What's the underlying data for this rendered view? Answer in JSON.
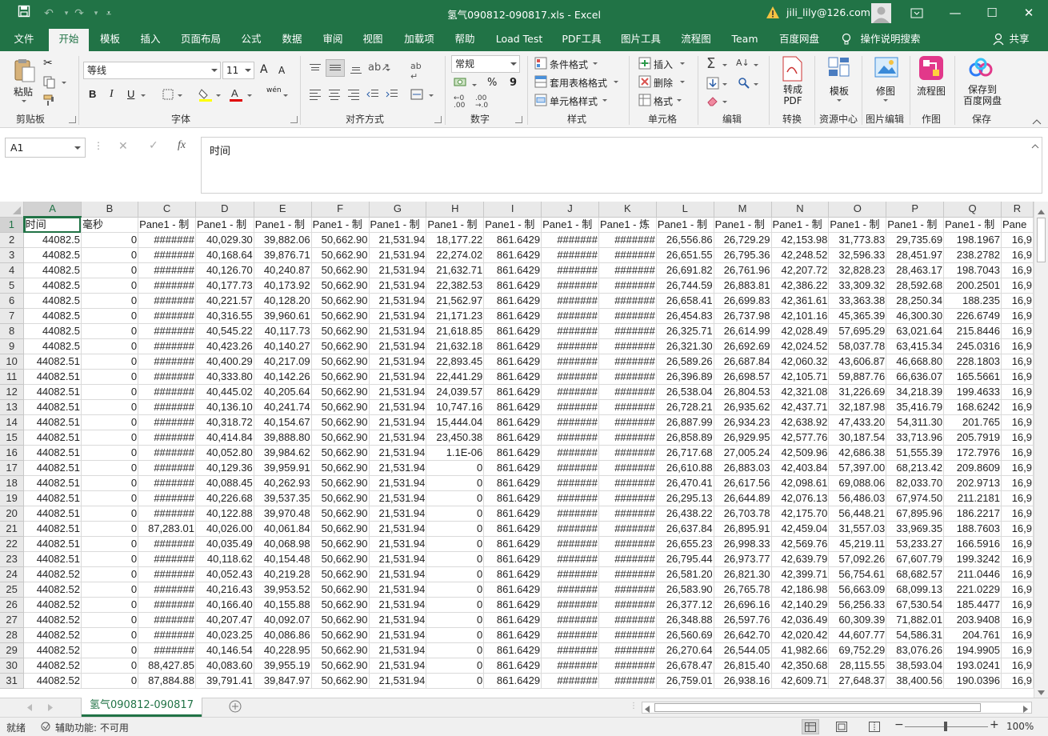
{
  "window": {
    "title": "氢气090812-090817.xls  -  Excel",
    "user": "jili_lily@126.com"
  },
  "tabs": [
    "文件",
    "开始",
    "模板",
    "插入",
    "页面布局",
    "公式",
    "数据",
    "审阅",
    "视图",
    "加载项",
    "帮助",
    "Load Test",
    "PDF工具",
    "图片工具",
    "流程图",
    "Team",
    "百度网盘",
    "操作说明搜索",
    "共享"
  ],
  "active_tab": "开始",
  "ribbon": {
    "clipboard": {
      "paste": "粘贴",
      "label": "剪贴板"
    },
    "font": {
      "name": "等线",
      "size": "11",
      "label": "字体",
      "bold": "B",
      "italic": "I",
      "underline": "U",
      "grow": "A",
      "shrink": "A",
      "phonetic": "wén"
    },
    "alignment": {
      "label": "对齐方式"
    },
    "number": {
      "format": "常规",
      "percent": "%",
      "comma": "9",
      "label": "数字"
    },
    "styles": {
      "conditional": "条件格式",
      "table": "套用表格格式",
      "cell": "单元格样式",
      "label": "样式"
    },
    "cells": {
      "insert": "插入",
      "delete": "删除",
      "format": "格式",
      "label": "单元格"
    },
    "editing": {
      "label": "编辑"
    },
    "convert": {
      "button": "转成\nPDF",
      "label": "转换"
    },
    "templates": {
      "button": "模板",
      "label": "资源中心"
    },
    "image_fix": {
      "button": "修图",
      "label": "图片编辑"
    },
    "flowchart": {
      "button": "流程图",
      "label": "作图"
    },
    "baidu": {
      "button": "保存到\n百度网盘",
      "label": "保存"
    }
  },
  "formula_bar": {
    "name_box": "A1",
    "fx": "fx",
    "content": "时间"
  },
  "columns": [
    "A",
    "B",
    "C",
    "D",
    "E",
    "F",
    "G",
    "H",
    "I",
    "J",
    "K",
    "L",
    "M",
    "N",
    "O",
    "P",
    "Q",
    "R"
  ],
  "header_row": [
    "时间",
    "毫秒",
    "Pane1 - 制",
    "Pane1 - 制",
    "Pane1 - 制",
    "Pane1 - 制",
    "Pane1 - 制",
    "Pane1 - 制",
    "Pane1 - 制",
    "Pane1 - 制",
    "Pane1 - 炼",
    "Pane1 - 制",
    "Pane1 - 制",
    "Pane1 - 制",
    "Pane1 - 制",
    "Pane1 - 制",
    "Pane1 - 制",
    "Pane"
  ],
  "rows": [
    [
      "2",
      "44082.5",
      "0",
      "#######",
      "40,029.30",
      "39,882.06",
      "50,662.90",
      "21,531.94",
      "18,177.22",
      "861.6429",
      "#######",
      "#######",
      "26,556.86",
      "26,729.29",
      "42,153.98",
      "31,773.83",
      "29,735.69",
      "198.1967",
      "16,9"
    ],
    [
      "3",
      "44082.5",
      "0",
      "#######",
      "40,168.64",
      "39,876.71",
      "50,662.90",
      "21,531.94",
      "22,274.02",
      "861.6429",
      "#######",
      "#######",
      "26,651.55",
      "26,795.36",
      "42,248.52",
      "32,596.33",
      "28,451.97",
      "238.2782",
      "16,9"
    ],
    [
      "4",
      "44082.5",
      "0",
      "#######",
      "40,126.70",
      "40,240.87",
      "50,662.90",
      "21,531.94",
      "21,632.71",
      "861.6429",
      "#######",
      "#######",
      "26,691.82",
      "26,761.96",
      "42,207.72",
      "32,828.23",
      "28,463.17",
      "198.7043",
      "16,9"
    ],
    [
      "5",
      "44082.5",
      "0",
      "#######",
      "40,177.73",
      "40,173.92",
      "50,662.90",
      "21,531.94",
      "22,382.53",
      "861.6429",
      "#######",
      "#######",
      "26,744.59",
      "26,883.81",
      "42,386.22",
      "33,309.32",
      "28,592.68",
      "200.2501",
      "16,9"
    ],
    [
      "6",
      "44082.5",
      "0",
      "#######",
      "40,221.57",
      "40,128.20",
      "50,662.90",
      "21,531.94",
      "21,562.97",
      "861.6429",
      "#######",
      "#######",
      "26,658.41",
      "26,699.83",
      "42,361.61",
      "33,363.38",
      "28,250.34",
      "188.235",
      "16,9"
    ],
    [
      "7",
      "44082.5",
      "0",
      "#######",
      "40,316.55",
      "39,960.61",
      "50,662.90",
      "21,531.94",
      "21,171.23",
      "861.6429",
      "#######",
      "#######",
      "26,454.83",
      "26,737.98",
      "42,101.16",
      "45,365.39",
      "46,300.30",
      "226.6749",
      "16,9"
    ],
    [
      "8",
      "44082.5",
      "0",
      "#######",
      "40,545.22",
      "40,117.73",
      "50,662.90",
      "21,531.94",
      "21,618.85",
      "861.6429",
      "#######",
      "#######",
      "26,325.71",
      "26,614.99",
      "42,028.49",
      "57,695.29",
      "63,021.64",
      "215.8446",
      "16,9"
    ],
    [
      "9",
      "44082.5",
      "0",
      "#######",
      "40,423.26",
      "40,140.27",
      "50,662.90",
      "21,531.94",
      "21,632.18",
      "861.6429",
      "#######",
      "#######",
      "26,321.30",
      "26,692.69",
      "42,024.52",
      "58,037.78",
      "63,415.34",
      "245.0316",
      "16,9"
    ],
    [
      "10",
      "44082.51",
      "0",
      "#######",
      "40,400.29",
      "40,217.09",
      "50,662.90",
      "21,531.94",
      "22,893.45",
      "861.6429",
      "#######",
      "#######",
      "26,589.26",
      "26,687.84",
      "42,060.32",
      "43,606.87",
      "46,668.80",
      "228.1803",
      "16,9"
    ],
    [
      "11",
      "44082.51",
      "0",
      "#######",
      "40,333.80",
      "40,142.26",
      "50,662.90",
      "21,531.94",
      "22,441.29",
      "861.6429",
      "#######",
      "#######",
      "26,396.89",
      "26,698.57",
      "42,105.71",
      "59,887.76",
      "66,636.07",
      "165.5661",
      "16,9"
    ],
    [
      "12",
      "44082.51",
      "0",
      "#######",
      "40,445.02",
      "40,205.64",
      "50,662.90",
      "21,531.94",
      "24,039.57",
      "861.6429",
      "#######",
      "#######",
      "26,538.04",
      "26,804.53",
      "42,321.08",
      "31,226.69",
      "34,218.39",
      "199.4633",
      "16,9"
    ],
    [
      "13",
      "44082.51",
      "0",
      "#######",
      "40,136.10",
      "40,241.74",
      "50,662.90",
      "21,531.94",
      "10,747.16",
      "861.6429",
      "#######",
      "#######",
      "26,728.21",
      "26,935.62",
      "42,437.71",
      "32,187.98",
      "35,416.79",
      "168.6242",
      "16,9"
    ],
    [
      "14",
      "44082.51",
      "0",
      "#######",
      "40,318.72",
      "40,154.67",
      "50,662.90",
      "21,531.94",
      "15,444.04",
      "861.6429",
      "#######",
      "#######",
      "26,887.99",
      "26,934.23",
      "42,638.92",
      "47,433.20",
      "54,311.30",
      "201.765",
      "16,9"
    ],
    [
      "15",
      "44082.51",
      "0",
      "#######",
      "40,414.84",
      "39,888.80",
      "50,662.90",
      "21,531.94",
      "23,450.38",
      "861.6429",
      "#######",
      "#######",
      "26,858.89",
      "26,929.95",
      "42,577.76",
      "30,187.54",
      "33,713.96",
      "205.7919",
      "16,9"
    ],
    [
      "16",
      "44082.51",
      "0",
      "#######",
      "40,052.80",
      "39,984.62",
      "50,662.90",
      "21,531.94",
      "1.1E-06",
      "861.6429",
      "#######",
      "#######",
      "26,717.68",
      "27,005.24",
      "42,509.96",
      "42,686.38",
      "51,555.39",
      "172.7976",
      "16,9"
    ],
    [
      "17",
      "44082.51",
      "0",
      "#######",
      "40,129.36",
      "39,959.91",
      "50,662.90",
      "21,531.94",
      "0",
      "861.6429",
      "#######",
      "#######",
      "26,610.88",
      "26,883.03",
      "42,403.84",
      "57,397.00",
      "68,213.42",
      "209.8609",
      "16,9"
    ],
    [
      "18",
      "44082.51",
      "0",
      "#######",
      "40,088.45",
      "40,262.93",
      "50,662.90",
      "21,531.94",
      "0",
      "861.6429",
      "#######",
      "#######",
      "26,470.41",
      "26,617.56",
      "42,098.61",
      "69,088.06",
      "82,033.70",
      "202.9713",
      "16,9"
    ],
    [
      "19",
      "44082.51",
      "0",
      "#######",
      "40,226.68",
      "39,537.35",
      "50,662.90",
      "21,531.94",
      "0",
      "861.6429",
      "#######",
      "#######",
      "26,295.13",
      "26,644.89",
      "42,076.13",
      "56,486.03",
      "67,974.50",
      "211.2181",
      "16,9"
    ],
    [
      "20",
      "44082.51",
      "0",
      "#######",
      "40,122.88",
      "39,970.48",
      "50,662.90",
      "21,531.94",
      "0",
      "861.6429",
      "#######",
      "#######",
      "26,438.22",
      "26,703.78",
      "42,175.70",
      "56,448.21",
      "67,895.96",
      "186.2217",
      "16,9"
    ],
    [
      "21",
      "44082.51",
      "0",
      "87,283.01",
      "40,026.00",
      "40,061.84",
      "50,662.90",
      "21,531.94",
      "0",
      "861.6429",
      "#######",
      "#######",
      "26,637.84",
      "26,895.91",
      "42,459.04",
      "31,557.03",
      "33,969.35",
      "188.7603",
      "16,9"
    ],
    [
      "22",
      "44082.51",
      "0",
      "#######",
      "40,035.49",
      "40,068.98",
      "50,662.90",
      "21,531.94",
      "0",
      "861.6429",
      "#######",
      "#######",
      "26,655.23",
      "26,998.33",
      "42,569.76",
      "45,219.11",
      "53,233.27",
      "166.5916",
      "16,9"
    ],
    [
      "23",
      "44082.51",
      "0",
      "#######",
      "40,118.62",
      "40,154.48",
      "50,662.90",
      "21,531.94",
      "0",
      "861.6429",
      "#######",
      "#######",
      "26,795.44",
      "26,973.77",
      "42,639.79",
      "57,092.26",
      "67,607.79",
      "199.3242",
      "16,9"
    ],
    [
      "24",
      "44082.52",
      "0",
      "#######",
      "40,052.43",
      "40,219.28",
      "50,662.90",
      "21,531.94",
      "0",
      "861.6429",
      "#######",
      "#######",
      "26,581.20",
      "26,821.30",
      "42,399.71",
      "56,754.61",
      "68,682.57",
      "211.0446",
      "16,9"
    ],
    [
      "25",
      "44082.52",
      "0",
      "#######",
      "40,216.43",
      "39,953.52",
      "50,662.90",
      "21,531.94",
      "0",
      "861.6429",
      "#######",
      "#######",
      "26,583.90",
      "26,765.78",
      "42,186.98",
      "56,663.09",
      "68,099.13",
      "221.0229",
      "16,9"
    ],
    [
      "26",
      "44082.52",
      "0",
      "#######",
      "40,166.40",
      "40,155.88",
      "50,662.90",
      "21,531.94",
      "0",
      "861.6429",
      "#######",
      "#######",
      "26,377.12",
      "26,696.16",
      "42,140.29",
      "56,256.33",
      "67,530.54",
      "185.4477",
      "16,9"
    ],
    [
      "27",
      "44082.52",
      "0",
      "#######",
      "40,207.47",
      "40,092.07",
      "50,662.90",
      "21,531.94",
      "0",
      "861.6429",
      "#######",
      "#######",
      "26,348.88",
      "26,597.76",
      "42,036.49",
      "60,309.39",
      "71,882.01",
      "203.9408",
      "16,9"
    ],
    [
      "28",
      "44082.52",
      "0",
      "#######",
      "40,023.25",
      "40,086.86",
      "50,662.90",
      "21,531.94",
      "0",
      "861.6429",
      "#######",
      "#######",
      "26,560.69",
      "26,642.70",
      "42,020.42",
      "44,607.77",
      "54,586.31",
      "204.761",
      "16,9"
    ],
    [
      "29",
      "44082.52",
      "0",
      "#######",
      "40,146.54",
      "40,228.95",
      "50,662.90",
      "21,531.94",
      "0",
      "861.6429",
      "#######",
      "#######",
      "26,270.64",
      "26,544.05",
      "41,982.66",
      "69,752.29",
      "83,076.26",
      "194.9905",
      "16,9"
    ],
    [
      "30",
      "44082.52",
      "0",
      "88,427.85",
      "40,083.60",
      "39,955.19",
      "50,662.90",
      "21,531.94",
      "0",
      "861.6429",
      "#######",
      "#######",
      "26,678.47",
      "26,815.40",
      "42,350.68",
      "28,115.55",
      "38,593.04",
      "193.0241",
      "16,9"
    ],
    [
      "31",
      "44082.52",
      "0",
      "87,884.88",
      "39,791.41",
      "39,847.97",
      "50,662.90",
      "21,531.94",
      "0",
      "861.6429",
      "#######",
      "#######",
      "26,759.01",
      "26,938.16",
      "42,609.71",
      "27,648.37",
      "38,400.56",
      "190.0396",
      "16,9"
    ]
  ],
  "sheet_tab": "氢气090812-090817",
  "status": {
    "ready": "就绪",
    "accessibility": "辅助功能: 不可用",
    "zoom": "100%"
  },
  "colors": {
    "brand": "#217346"
  }
}
